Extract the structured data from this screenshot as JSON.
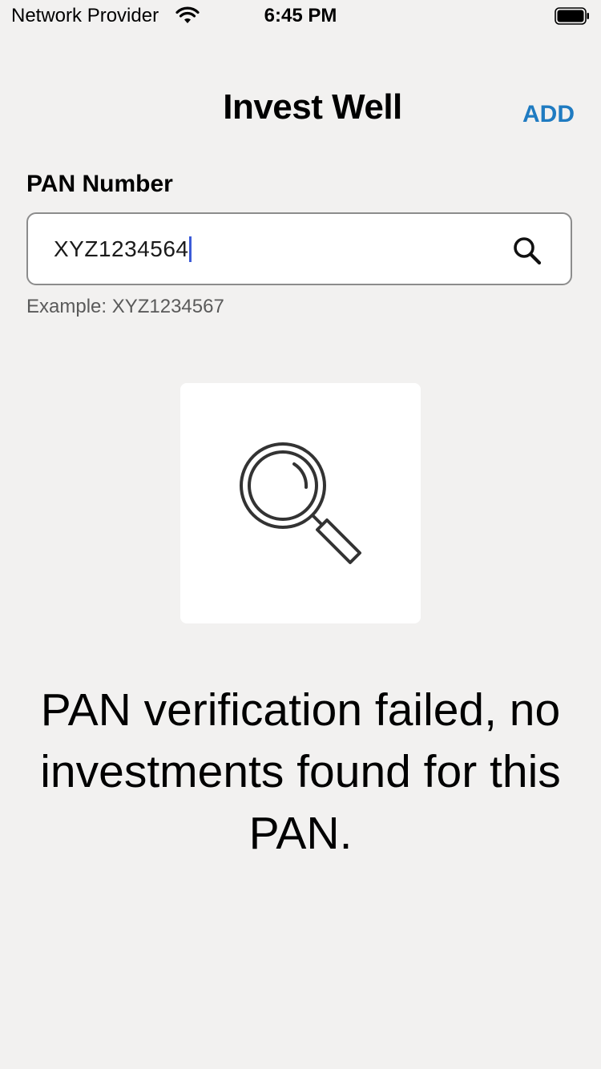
{
  "status_bar": {
    "carrier": "Network Provider",
    "time": "6:45 PM",
    "wifi_icon": "wifi-icon",
    "battery_icon": "battery-icon"
  },
  "header": {
    "title": "Invest Well",
    "add_label": "ADD"
  },
  "pan_form": {
    "label": "PAN Number",
    "value": "XYZ1234564",
    "search_icon": "search-icon",
    "hint": "Example: XYZ1234567"
  },
  "empty_state": {
    "icon": "magnifier-icon",
    "message": "PAN verification failed, no investments found for this PAN."
  },
  "colors": {
    "background": "#f2f1f0",
    "accent": "#1f7bc1",
    "caret": "#3c5bd8"
  }
}
